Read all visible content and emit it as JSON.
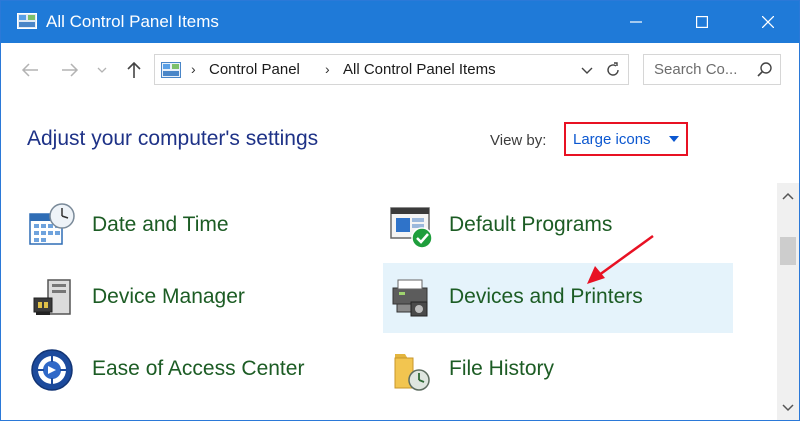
{
  "window": {
    "title": "All Control Panel Items"
  },
  "titlebar_buttons": [
    "minimize",
    "maximize",
    "close"
  ],
  "address": {
    "crumbs": [
      "Control Panel",
      "All Control Panel Items"
    ],
    "search_placeholder": "Search Co..."
  },
  "header": {
    "title": "Adjust your computer's settings",
    "view_by_label": "View by:",
    "view_by_value": "Large icons"
  },
  "items": [
    {
      "label": "Date and Time",
      "icon": "date-time-icon"
    },
    {
      "label": "Default Programs",
      "icon": "default-programs-icon"
    },
    {
      "label": "Device Manager",
      "icon": "device-manager-icon"
    },
    {
      "label": "Devices and Printers",
      "icon": "devices-printers-icon"
    },
    {
      "label": "Ease of Access Center",
      "icon": "ease-of-access-icon"
    },
    {
      "label": "File History",
      "icon": "file-history-icon"
    }
  ],
  "colors": {
    "titlebar": "#1f7ad8",
    "heading": "#1e3287",
    "item_link": "#1c5c24",
    "highlight_box": "#e81123",
    "hover": "#e5f3fb"
  }
}
